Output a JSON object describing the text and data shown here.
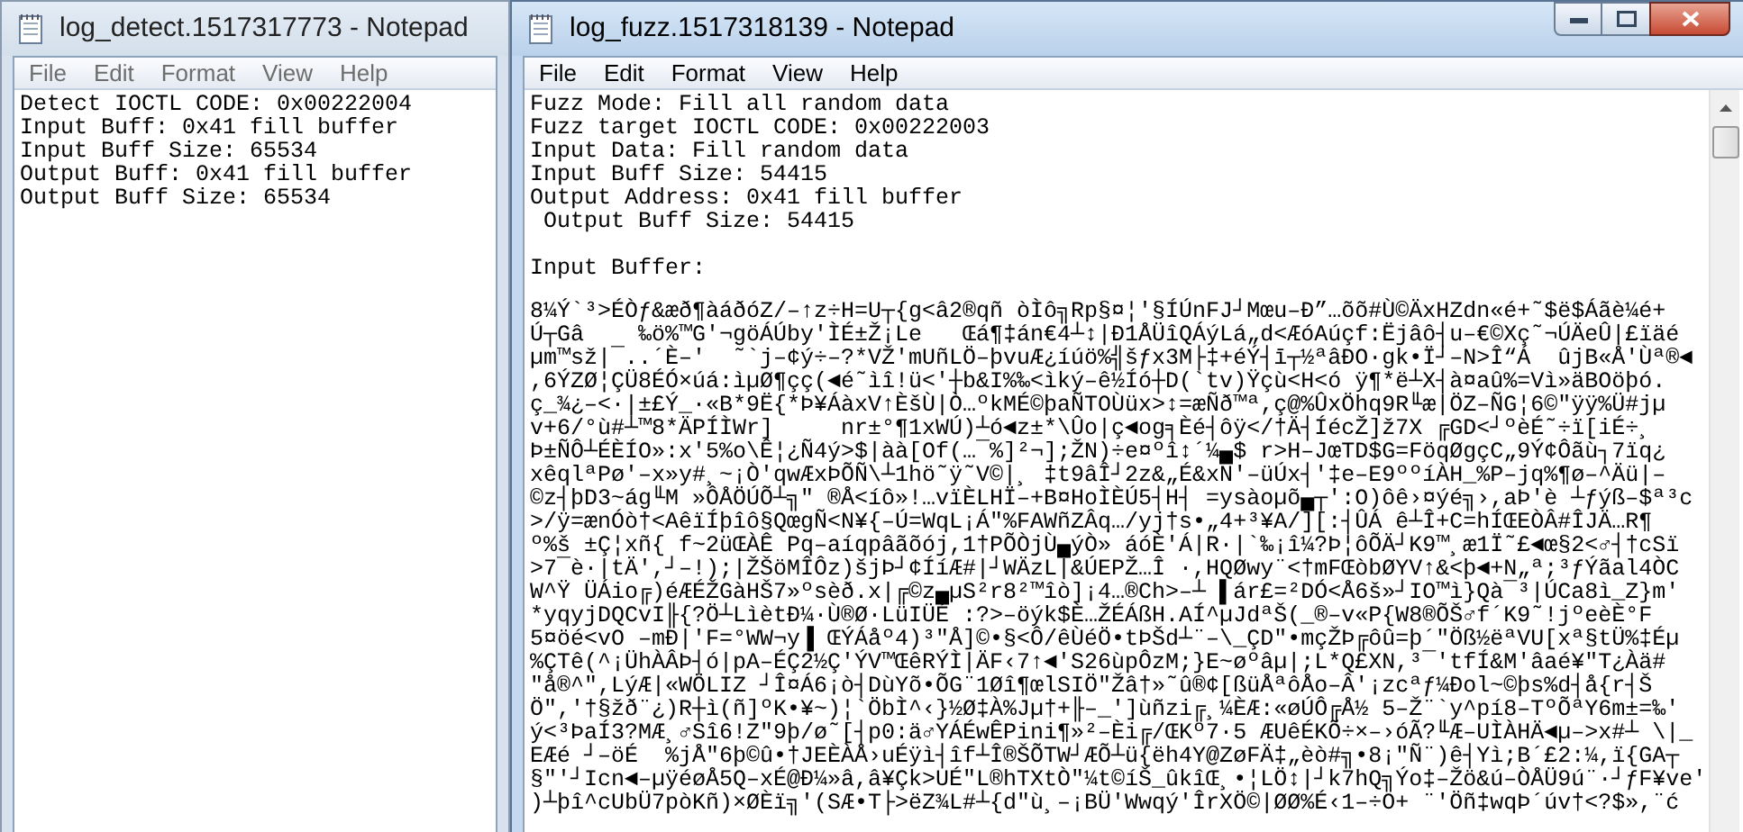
{
  "windows": [
    {
      "title": "log_detect.1517317773 - Notepad",
      "active": false,
      "menu": [
        "File",
        "Edit",
        "Format",
        "View",
        "Help"
      ],
      "lines": [
        "Detect IOCTL CODE: 0x00222004",
        "Input Buff: 0x41 fill buffer",
        "Input Buff Size: 65534",
        "Output Buff: 0x41 fill buffer",
        "Output Buff Size: 65534"
      ]
    },
    {
      "title": "log_fuzz.1517318139 - Notepad",
      "active": true,
      "menu": [
        "File",
        "Edit",
        "Format",
        "View",
        "Help"
      ],
      "lines": [
        "Fuzz Mode: Fill all random data",
        "Fuzz target IOCTL CODE: 0x00222003",
        "Input Data: Fill random data",
        "Input Buff Size: 54415",
        "Output Address: 0x41 fill buffer",
        " Output Buff Size: 54415"
      ],
      "section": "Input Buffer:",
      "buffer": [
        "8¼Ý`³>ÉÒƒ&æð¶àáðóZ/–↑z÷H=U┬{g<â2®qñ òÌô╗Rp§¤¦'§ÍÚnFJ┘Mœu–Ð”…õõ#Ù©ÄxHZdn«é+˜$ë$Áãè¼é+",
        "Ú┬Gâ    ‰ö%™G'¬göÁÚby'ÌÉ±Ž¡Le   Œá¶‡án€4┴↕|Ð1ÅÜîQÁýLá„d<ÆóAúçf:Ëjâô┤u–€©Xç˜¬ÚÄeÛ|£ïäé",
        "µm™sž|¯..´È–'  ˜`j–¢ý÷–?*VŽ'mUñLÖ–þvuÆ¿íúö%╣šƒx3M├‡+éÝ┤ī┬½ªâÐO·gk•Ï┘–N>Î“Á  ûjB«Å'Ùª®◄",
        ",6ÝZØ¦ÇÜ8ÉÓ×úá:ìµØ¶çç(◄é˜ìî!ü<'┼b&I%‰<ìký–ê½Íó┼D(`tv)Ÿçù<H<ó ÿ¶*ë┴X┤à¤aû%=Vì»äBOöþó.",
        "ç_¾¿–<·|±£Ý_·«B*9Ë{*Þ¥ÁàxV↑ÈšÙ|Ò…ºkMÉ©þaÑTOÙüx>↕=æÑð™ª,ç@%ÛxÖhq9R╙æ|ÖZ–ÑG¦6©\"ÿÿ%Ü#jµ",
        "v+6/°ù#┴™8*ÄPÍÌWr]     nr±°¶1xWÚ)┴ó◄z±*\\Ûo|ç◄og╕Èé┤ôÿ</†Ä┤ÍécŽ]ž7X ╔GD<┘ºèÉ˜÷ï[iÉ÷¸",
        "Þ±ÑÔ┴ÉÈÍO»:x'5%o\\Ê¦¿Ñ4ý>$|àà[Of(…¯%]²¬];ŽN)÷e¤ºî↕´¼▄$ r>H–JœTD$G=FöqØgçC„9Ý¢Ôãù┐7ïq¿",
        "xêqlªPø'–x»y#¸~¡Ò'qwÆxÞÕÑ\\┴1hö˜ÿ˜V©|¸ ‡t9âÎ┘2z&„É&xN'–üÚx┤'‡e–E9ººíÀH_%P–jq%¶ø–^Äü|–",
        "©z┤þD3~ág╙M »ÔÅÖÚÕ┴╗\" ®Å<íô»!…vïÈLHÏ–+B¤HoÌÈÚ5┤H┤ =ysàoµõ▄┬':O)ôê›¤ýé╗›,aÞ'è ┴ƒýß–$ª³c",
        ">/ÿ=ænÓò†<AêïÍþîô§QœgÑ<N¥{–Ú=WqL¡Á\"%FAWñZÂq…/yj†s•„4+³¥A/][:┤ÛÁ ê┴Î+C=hÍŒEÒÂ#ÎJÄ…R¶",
        "º%š ±Ç¦xñ{ f~2üŒÀÊ Pq–aíqpâãõój,1†PÕÒjÙ▄ýÒ» áóÈ'Á|R·|`‰¡î¼?Þ¦ôÕÄ┘K9™¸æ1Ï˜£◄œ§2<♂┤†cSï",
        ">7¯è·|tÄ',┘–!);|ŽŠöMÎÔz)šjÞ┘¢ÍíÆ#|┘WÄzL|&ÚEPŽ…Î ·,HQØwy¨<†mFŒòbØYV↑&<þ◄+N„ª;³ƒÝãal4ÒC",
        "W^Ÿ ÜÁio╔)éÆÉŽGàHŠ7»ºsèð.x|╔©z▄µS²r8²™îò]¡4…®Ch>–┴ ▌ár£=²DÓ<Å6š»┘IO™ì}Qà¯³|ÚCa8ì_Z}m'",
        "*yqyjDQCvI╟{?Ö┴LìètÐ¼·Ù®Ø·LüIÜÉ :?>–öýk$È…ŽÉÁßH.AÍ^µJdªŠ(_®–v«P{W8®ÕŠ♂f´K9˜!jºeèÈ°F",
        "5¤öé<vO –mÐ|'F=°WW¬y▐ ŒÝÁåº4)³\"Å]©•§<Ô/êÙéÖ•tÞŠd┴¨–\\_ÇD\"•mçŽÞ╔ôû=þ´\"Öß½ëªVU[xª§tÜ%‡Éµ",
        "%ÇTê(^¡ÜhÀÂÞ┤ó|pA–ÉÇ2½Ç'ÝV™ŒêRÝÌ|ÄF‹7↑◄'S26ùpÔzM;}E~øºâµ|;L*Q£XN,³¯'tfÍ&M'âaé¥\"T¿Àä#",
        "\"å®^\",LýÆ|«WÖLIZ ┘Î¤Á6¡ò┤DùYõ•ÕG¨1Øî¶œlSIÖ\"Žâ†»˜û®¢[ßüÅªôÅo–Â'¡zcªƒ¼Ðol~©þs%d┤å{r┤Š",
        "Ö\",'†§žð¨¿)R┼ì(ñ]ºK•¥~)¦`ÖbÌ^‹}½Ø‡À%Jµ†+╟–_']ùñzi╔¸¼ÈÆ:«øÚÔ╔Å½ 5–Ž¨`y^pí8–TºÕªY6m±=‰'",
        "ý<³ÞaÍ3?MÆ¸♂Sî6!Z\"9þ/ø˜[┤p0:ä♂YÁÉwÊPini¶»²–Èi╔/ŒKº7·5 ÆUêÉKÕ÷×–›óÃ?╙Æ–UÌÀHÄ◄µ–>x#┴ \\|_",
        "EÆé ┘–öÉ  %jÅ\"6þ©û•†JEÈÀÅ›uÉÿì┤îf┴Î®ŠÕTW┘ÆÕ┴ü{ëh4Y@ZøFÄ‡„èò#╗•8¡\"Ñ¨)ê┤Yì;B´£2:¼,ï{GA┬",
        "§\"'┘Icn◄–µÿéøÅ5Q–xÉ@Ð¼»â,â¥Çk>UÉ\"L®hTXtÒ\"¼t©íŠ_ûkîŒ¸•¦LÖ↕|┘k7hQ╗Ýo‡–Žö&ú–ÒÅÜ9ú¨·┘ƒF¥ve'",
        ")┴þî^cUbÜ7pòKñ)×ØÈï╗'(SÆ•T├>ëZ¾L#┴{d\"ù¸–¡BÜ'Wwqý'ÎrXÖ©|ØØ%É‹1–÷O+ ¨'Öñ‡wqÞ´úv†<?$»,¨ć"
      ]
    }
  ]
}
